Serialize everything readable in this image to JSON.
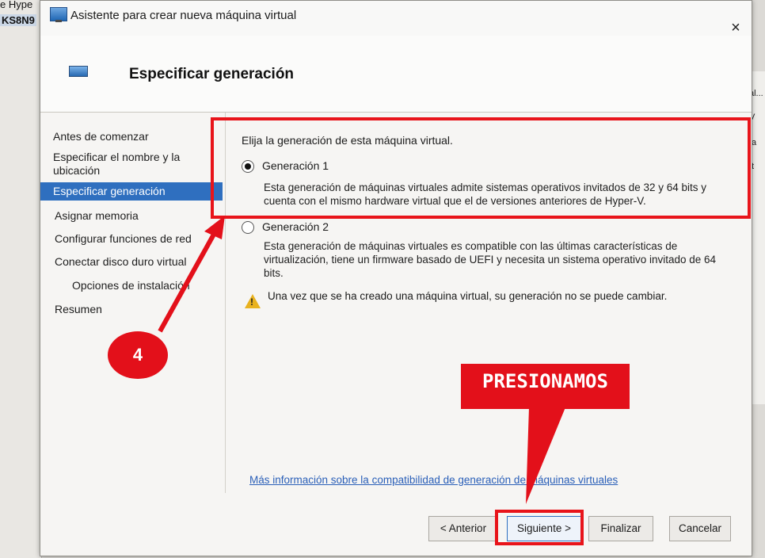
{
  "background": {
    "app_label_top": "e Hype",
    "app_label_host": "KS8N9",
    "right_texts": [
      "al...",
      "V",
      "ta",
      "tt"
    ]
  },
  "dialog": {
    "title": "Asistente para crear nueva máquina virtual",
    "close_symbol": "×",
    "page_heading": "Especificar generación"
  },
  "nav": {
    "items": [
      {
        "label": "Antes de comenzar"
      },
      {
        "label": "Especificar el nombre y la ubicación"
      },
      {
        "label": "Especificar generación"
      },
      {
        "label": "Asignar memoria"
      },
      {
        "label": "Configurar funciones de red"
      },
      {
        "label": "Conectar disco duro virtual"
      },
      {
        "label": "Opciones de instalación"
      },
      {
        "label": "Resumen"
      }
    ]
  },
  "content": {
    "prompt": "Elija la generación de esta máquina virtual.",
    "gen1_label": "Generación 1",
    "gen1_desc": "Esta generación de máquinas virtuales admite sistemas operativos invitados de 32 y 64 bits y cuenta con el mismo hardware virtual que el de versiones anteriores de Hyper-V.",
    "gen2_label": "Generación 2",
    "gen2_desc": "Esta generación de máquinas virtuales es compatible con las últimas características de virtualización, tiene un firmware basado de UEFI y necesita un sistema operativo invitado de 64 bits.",
    "warning": "Una vez que se ha creado una máquina virtual, su generación no se puede cambiar.",
    "more_link": "Más información sobre la compatibilidad de generación de máquinas virtuales"
  },
  "buttons": {
    "previous": "< Anterior",
    "next": "Siguiente >",
    "finish": "Finalizar",
    "cancel": "Cancelar"
  },
  "annotations": {
    "step_number": "4",
    "callout_text": "PRESIONAMOS",
    "color": "#e3101a"
  }
}
